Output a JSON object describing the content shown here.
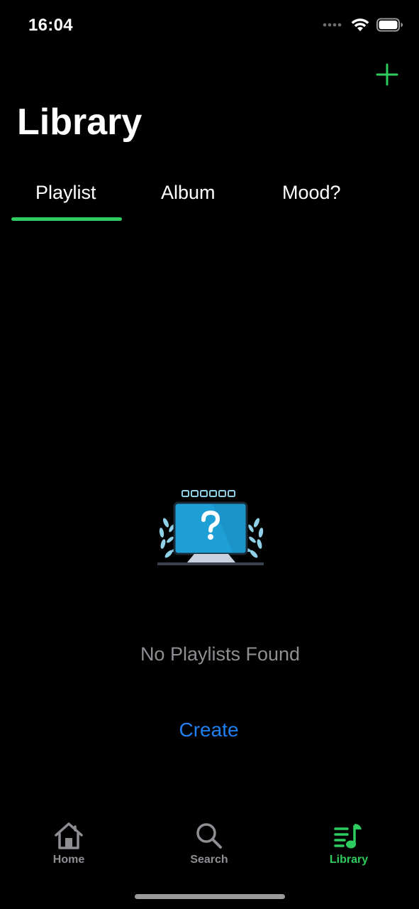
{
  "status_bar": {
    "time": "16:04",
    "icons": [
      "signal-dots-icon",
      "wifi-icon",
      "battery-icon"
    ]
  },
  "header": {
    "title": "Library",
    "add_icon": "plus-icon"
  },
  "tabs": [
    {
      "label": "Playlist",
      "selected": true
    },
    {
      "label": "Album",
      "selected": false
    },
    {
      "label": "Mood?",
      "selected": false
    }
  ],
  "empty_state": {
    "illustration": "monitor-question-icon",
    "message": "No Playlists Found",
    "action_label": "Create"
  },
  "tab_bar": {
    "items": [
      {
        "label": "Home",
        "icon": "home-icon",
        "active": false
      },
      {
        "label": "Search",
        "icon": "search-icon",
        "active": false
      },
      {
        "label": "Library",
        "icon": "music-library-icon",
        "active": true
      }
    ]
  },
  "colors": {
    "accent": "#2ecc5f",
    "link": "#1f7ff0",
    "inactive": "#8e8e93",
    "background": "#000000"
  }
}
